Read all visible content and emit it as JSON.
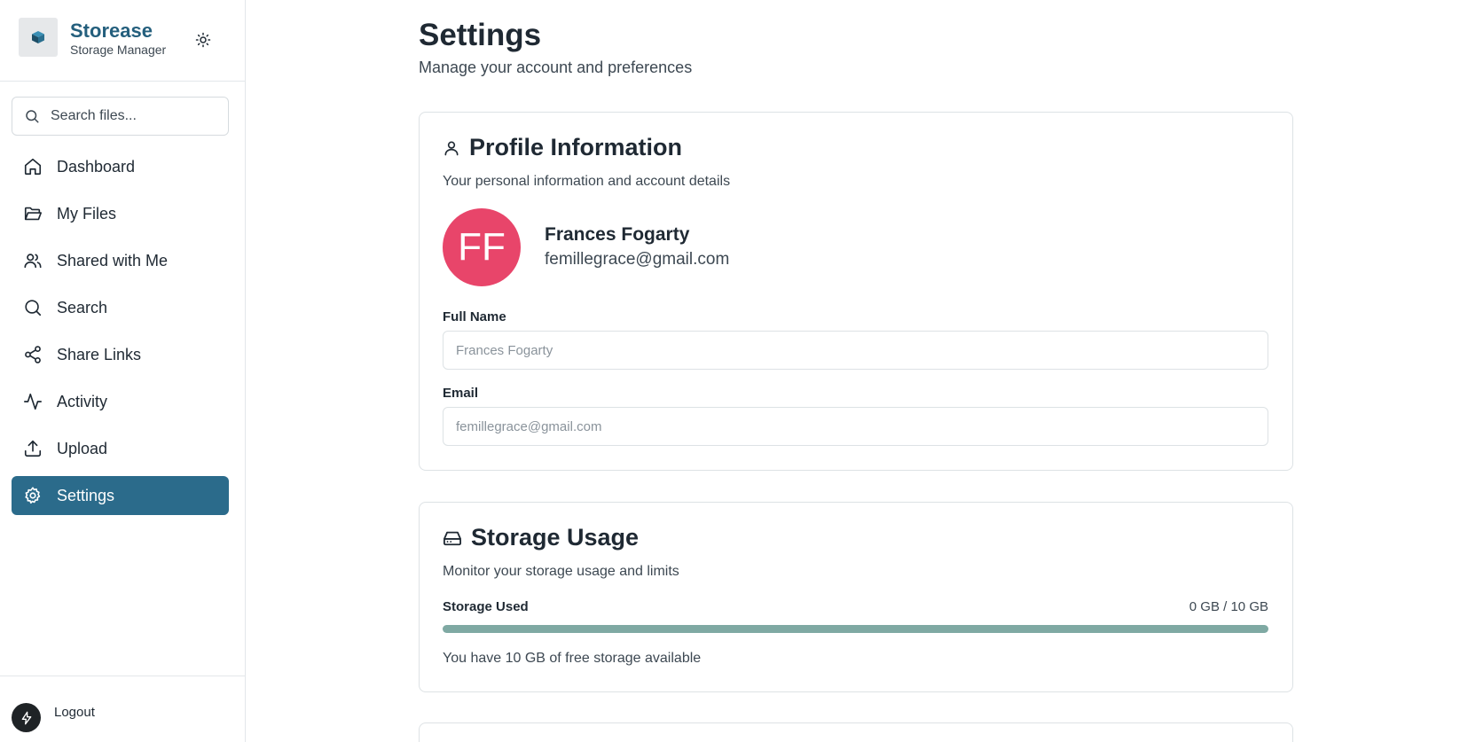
{
  "app": {
    "name": "Storease",
    "subtitle": "Storage Manager",
    "logo_icon": "cube-logo",
    "theme_icon": "sun-icon"
  },
  "search": {
    "placeholder": "Search files..."
  },
  "nav": {
    "items": [
      {
        "label": "Dashboard",
        "icon": "home-icon",
        "active": false
      },
      {
        "label": "My Files",
        "icon": "folder-open-icon",
        "active": false
      },
      {
        "label": "Shared with Me",
        "icon": "users-icon",
        "active": false
      },
      {
        "label": "Search",
        "icon": "search-icon",
        "active": false
      },
      {
        "label": "Share Links",
        "icon": "share-icon",
        "active": false
      },
      {
        "label": "Activity",
        "icon": "activity-icon",
        "active": false
      },
      {
        "label": "Upload",
        "icon": "upload-icon",
        "active": false
      },
      {
        "label": "Settings",
        "icon": "gear-icon",
        "active": true
      }
    ]
  },
  "footer": {
    "logout_label": "Logout"
  },
  "page": {
    "title": "Settings",
    "subtitle": "Manage your account and preferences"
  },
  "profile": {
    "title": "Profile Information",
    "description": "Your personal information and account details",
    "initials": "FF",
    "name": "Frances Fogarty",
    "email": "femillegrace@gmail.com",
    "full_name_label": "Full Name",
    "full_name_placeholder": "Frances Fogarty",
    "email_label": "Email",
    "email_placeholder": "femillegrace@gmail.com"
  },
  "storage": {
    "title": "Storage Usage",
    "description": "Monitor your storage usage and limits",
    "used_label": "Storage Used",
    "used_value": "0 GB / 10 GB",
    "used_fraction": 0,
    "note": "You have 10 GB of free storage available"
  },
  "colors": {
    "brand": "#245f7d",
    "active_nav": "#2b6b8b",
    "avatar": "#e8456a",
    "progress_track": "#7fa9a3"
  }
}
